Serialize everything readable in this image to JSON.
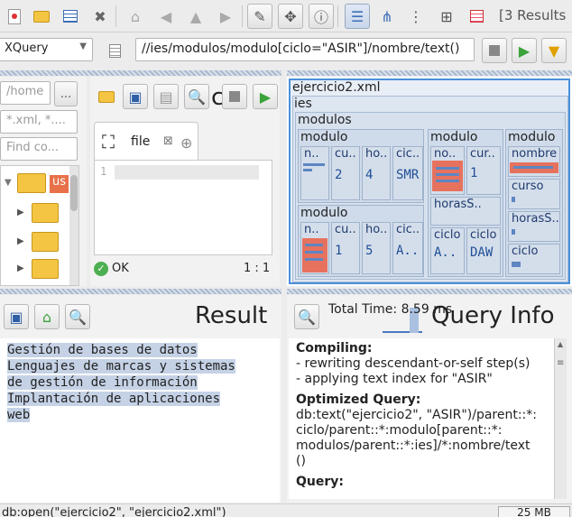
{
  "toolbar": {
    "results_label": "[3 Results"
  },
  "query": {
    "mode": "XQuery",
    "expression": "//ies/modulos/modulo[ciclo=\"ASIR\"]/nombre/text()"
  },
  "project": {
    "path_placeholder": "/home",
    "filter_placeholder": "*.xml, *....",
    "find_placeholder": "Find co...",
    "browse_label": "...",
    "folder_label": "us"
  },
  "editor": {
    "tab_label": "file",
    "line_number": "1",
    "status": "OK",
    "position": "1 : 1",
    "title_partial": "c"
  },
  "treemap": {
    "root": "ejercicio2.xml",
    "ies": "ies",
    "modulos": "modulos",
    "modulo": "modulo",
    "n_dots": "n..",
    "cu_dots": "cu..",
    "ho_dots": "ho..",
    "cic_dots": "cic..",
    "no_dots": "no..",
    "cur_dots": "cur..",
    "horas_dots": "horasS..",
    "horas_s": "horasS..",
    "ciclo": "ciclo",
    "nombre": "nombre",
    "curso": "curso",
    "m1": {
      "curso": "2",
      "horas": "4",
      "ciclo": "SMR"
    },
    "m2": {
      "curso": "1",
      "horas": "5",
      "ciclo": "A.."
    },
    "m3": {
      "curso": "1",
      "ciclo": "A..",
      "ciclo2": "DAW"
    }
  },
  "result": {
    "title": "Result",
    "lines": [
      "Gestión de bases de datos",
      "Lenguajes de marcas y sistemas",
      "de gestión de información",
      "Implantación de aplicaciones",
      "web"
    ]
  },
  "info": {
    "title": "Query Info",
    "total_time": "Total Time: 8.59 ms",
    "compiling_heading": "Compiling:",
    "compiling_lines": [
      "- rewriting descendant-or-self step(s)",
      "- applying text index for \"ASIR\""
    ],
    "optimized_heading": "Optimized Query:",
    "optimized_text": [
      "db:text(\"ejercicio2\", \"ASIR\")/parent::*:",
      "ciclo/parent::*:modulo[parent::*:",
      "modulos/parent::*:ies]/*:nombre/text",
      "()"
    ],
    "query_heading": "Query:"
  },
  "statusbar": {
    "command": "db:open(\"ejercicio2\", \"ejercicio2.xml\")",
    "memory": "25 MB"
  }
}
